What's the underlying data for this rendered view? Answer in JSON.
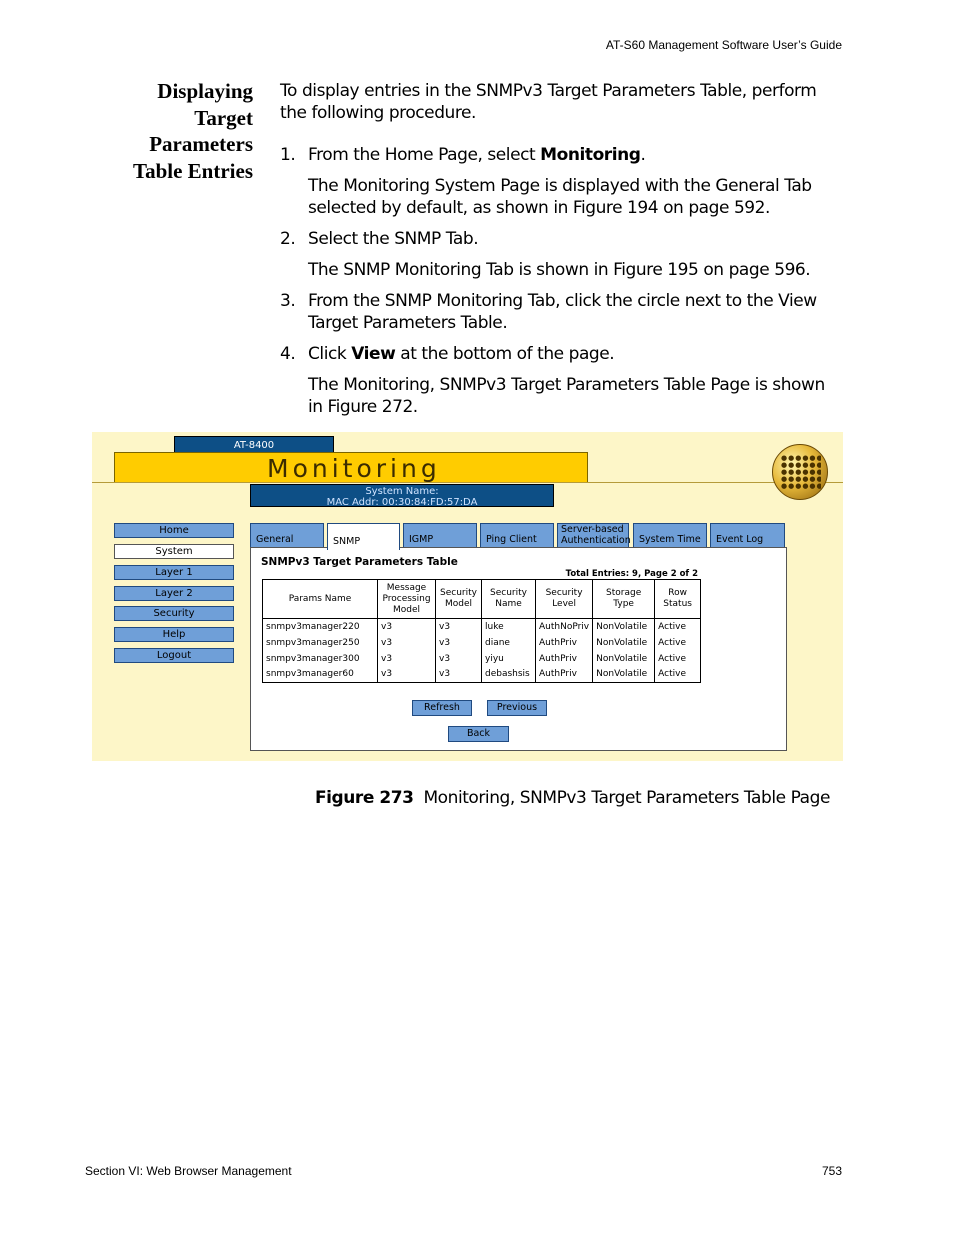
{
  "header": {
    "title": "AT-S60 Management Software User’s Guide"
  },
  "section": {
    "heading_lines": [
      "Displaying",
      "Target",
      "Parameters",
      "Table Entries"
    ],
    "intro": "To display entries in the SNMPv3 Target Parameters Table, perform the following procedure.",
    "steps": [
      {
        "num": "1.",
        "pre": "From the Home Page, select ",
        "bold": "Monitoring",
        "post": "."
      },
      {
        "num": "2.",
        "text": "Select the SNMP Tab."
      },
      {
        "num": "3.",
        "text": "From the SNMP Monitoring Tab, click the circle next to the View Target Parameters Table."
      },
      {
        "num": "4.",
        "pre": "Click ",
        "bold": "View",
        "post": " at the bottom of the page."
      }
    ],
    "notes": [
      "The Monitoring System Page is displayed with the General Tab selected by default, as shown in Figure 194 on page 592.",
      "The SNMP Monitoring Tab is shown in Figure 195 on page 596.",
      "The Monitoring, SNMPv3 Target Parameters Table Page is shown in Figure 272."
    ]
  },
  "screenshot": {
    "model": "AT-8400",
    "banner_title": "Monitoring",
    "system_name_line": "System Name:",
    "mac_line": "MAC Addr: 00:30:84:FD:57:DA",
    "nav": [
      "Home",
      "System",
      "Layer 1",
      "Layer 2",
      "Security",
      "Help",
      "Logout"
    ],
    "tabs": [
      "General",
      "SNMP",
      "IGMP",
      "Ping Client",
      "Server-based",
      "Authentication",
      "System Time",
      "Event Log"
    ],
    "panel_title": "SNMPv3 Target Parameters Table",
    "total_entries": "Total Entries: 9, Page 2 of 2",
    "columns": [
      [
        "Params Name"
      ],
      [
        "Message",
        "Processing",
        "Model"
      ],
      [
        "Security",
        "Model"
      ],
      [
        "Security",
        "Name"
      ],
      [
        "Security",
        "Level"
      ],
      [
        "Storage",
        "Type"
      ],
      [
        "Row",
        "Status"
      ]
    ],
    "rows": [
      [
        "snmpv3manager220",
        "v3",
        "v3",
        "luke",
        "AuthNoPriv",
        "NonVolatile",
        "Active"
      ],
      [
        "snmpv3manager250",
        "v3",
        "v3",
        "diane",
        "AuthPriv",
        "NonVolatile",
        "Active"
      ],
      [
        "snmpv3manager300",
        "v3",
        "v3",
        "yiyu",
        "AuthPriv",
        "NonVolatile",
        "Active"
      ],
      [
        "snmpv3manager60",
        "v3",
        "v3",
        "debashsis",
        "AuthPriv",
        "NonVolatile",
        "Active"
      ]
    ],
    "buttons": {
      "refresh": "Refresh",
      "previous": "Previous",
      "back": "Back"
    }
  },
  "caption": {
    "label": "Figure 273",
    "text": "Monitoring, SNMPv3 Target Parameters Table Page"
  },
  "footer": {
    "left": "Section VI: Web Browser Management",
    "right": "753"
  }
}
